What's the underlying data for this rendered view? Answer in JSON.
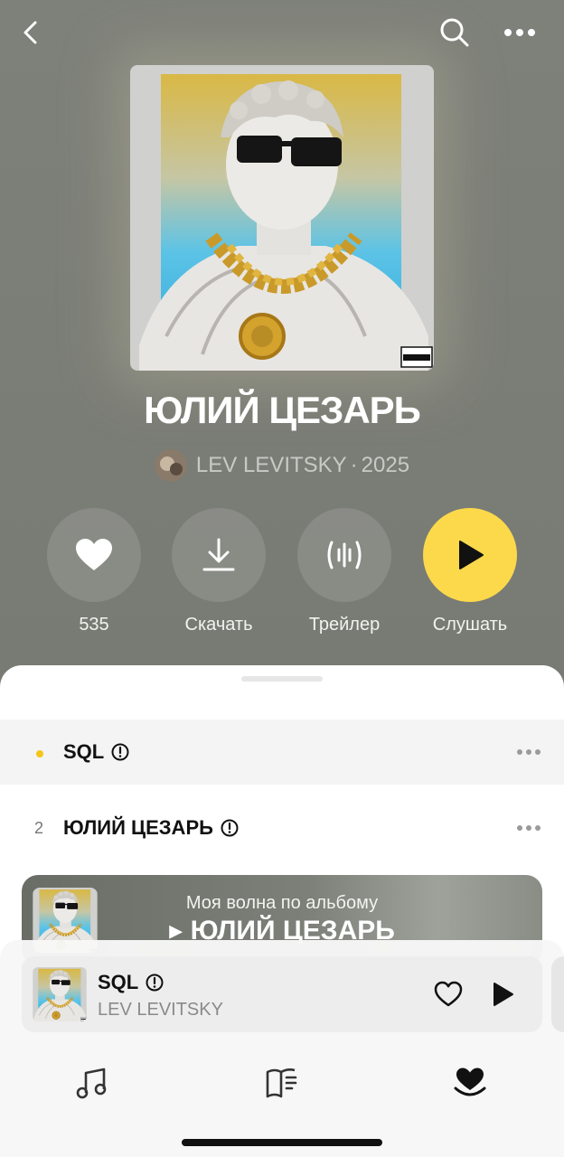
{
  "header": {
    "back_icon": "chevron-left-icon",
    "search_icon": "search-icon",
    "more_icon": "ellipsis-icon"
  },
  "album": {
    "title": "ЮЛИЙ ЦЕЗАРЬ",
    "artist": "LEV LEVITSKY",
    "separator": "·",
    "year": "2025",
    "advisory_text": "PARENTAL ADVISORY EXPLICIT CONTENT"
  },
  "actions": [
    {
      "label": "535",
      "icon": "heart-icon"
    },
    {
      "label": "Скачать",
      "icon": "download-icon"
    },
    {
      "label": "Трейлер",
      "icon": "waveform-icon"
    },
    {
      "label": "Слушать",
      "icon": "play-icon"
    }
  ],
  "tracks": [
    {
      "number": "",
      "title": "SQL",
      "explicit_icon": "explicit-icon",
      "active": true
    },
    {
      "number": "2",
      "title": "ЮЛИЙ ЦЕЗАРЬ",
      "explicit_icon": "explicit-icon",
      "active": false
    }
  ],
  "wave": {
    "subtitle": "Моя волна по альбому",
    "title": "▸ ЮЛИЙ ЦЕЗАРЬ"
  },
  "mini_player": {
    "title": "SQL",
    "artist": "LEV LEVITSKY",
    "like_icon": "heart-outline-icon",
    "play_icon": "play-icon"
  },
  "tabs": [
    {
      "name": "music",
      "icon": "music-note-icon"
    },
    {
      "name": "library",
      "icon": "book-icon"
    },
    {
      "name": "favorites",
      "icon": "heart-tab-icon"
    }
  ],
  "colors": {
    "background": "#7a7c76",
    "accent_yellow": "#fbd94b",
    "active_dot": "#f5c518"
  }
}
